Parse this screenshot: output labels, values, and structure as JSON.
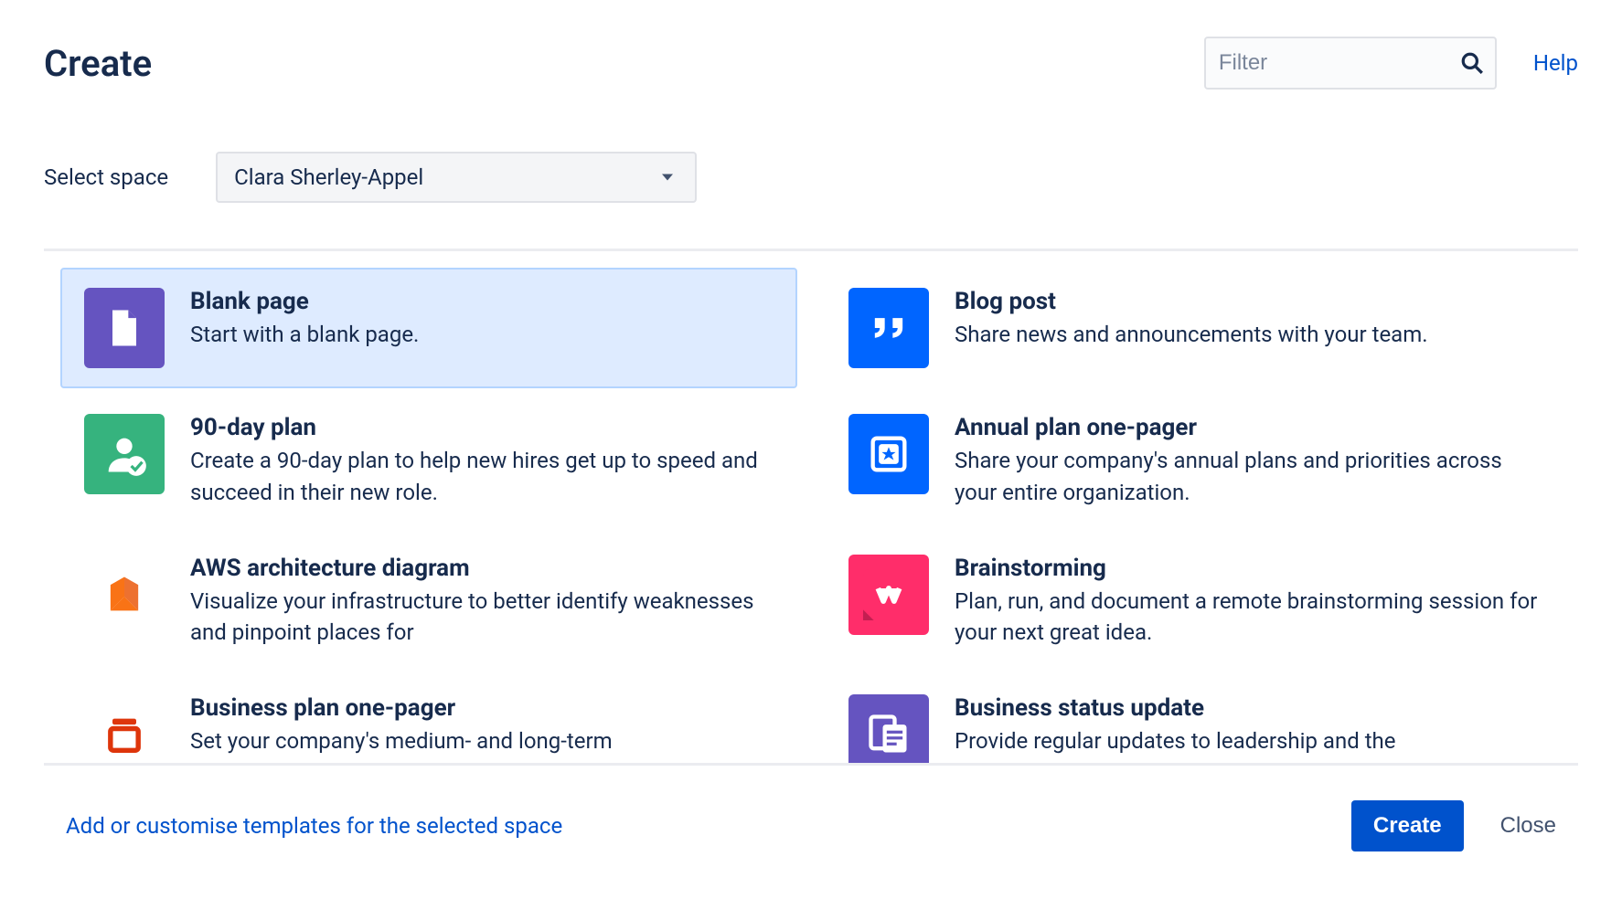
{
  "header": {
    "title": "Create",
    "filter_placeholder": "Filter",
    "help_label": "Help"
  },
  "space": {
    "label": "Select space",
    "selected": "Clara Sherley-Appel"
  },
  "templates": [
    {
      "title": "Blank page",
      "description": "Start with a blank page.",
      "icon": "page-icon",
      "bg": "ic-purple",
      "selected": true
    },
    {
      "title": "Blog post",
      "description": "Share news and announcements with your team.",
      "icon": "quote-icon",
      "bg": "ic-blue",
      "selected": false
    },
    {
      "title": "90-day plan",
      "description": "Create a 90-day plan to help new hires get up to speed and succeed in their new role.",
      "icon": "person-check-icon",
      "bg": "ic-green",
      "selected": false
    },
    {
      "title": "Annual plan one-pager",
      "description": "Share your company's annual plans and priorities across your entire organization.",
      "icon": "star-doc-icon",
      "bg": "ic-blue",
      "selected": false
    },
    {
      "title": "AWS architecture diagram",
      "description": "Visualize your infrastructure to better identify weaknesses and pinpoint places for",
      "icon": "lucid-icon",
      "bg": "ic-white",
      "selected": false
    },
    {
      "title": "Brainstorming",
      "description": "Plan, run, and document a remote brainstorming session for your next great idea.",
      "icon": "mural-icon",
      "bg": "ic-pink",
      "selected": false
    },
    {
      "title": "Business plan one-pager",
      "description": "Set your company's medium- and long-term",
      "icon": "archive-icon",
      "bg": "ic-white",
      "selected": false
    },
    {
      "title": "Business status update",
      "description": "Provide regular updates to leadership and the",
      "icon": "status-doc-icon",
      "bg": "ic-purple",
      "selected": false
    }
  ],
  "footer": {
    "customize_link": "Add or customise templates for the selected space",
    "create_label": "Create",
    "close_label": "Close"
  }
}
